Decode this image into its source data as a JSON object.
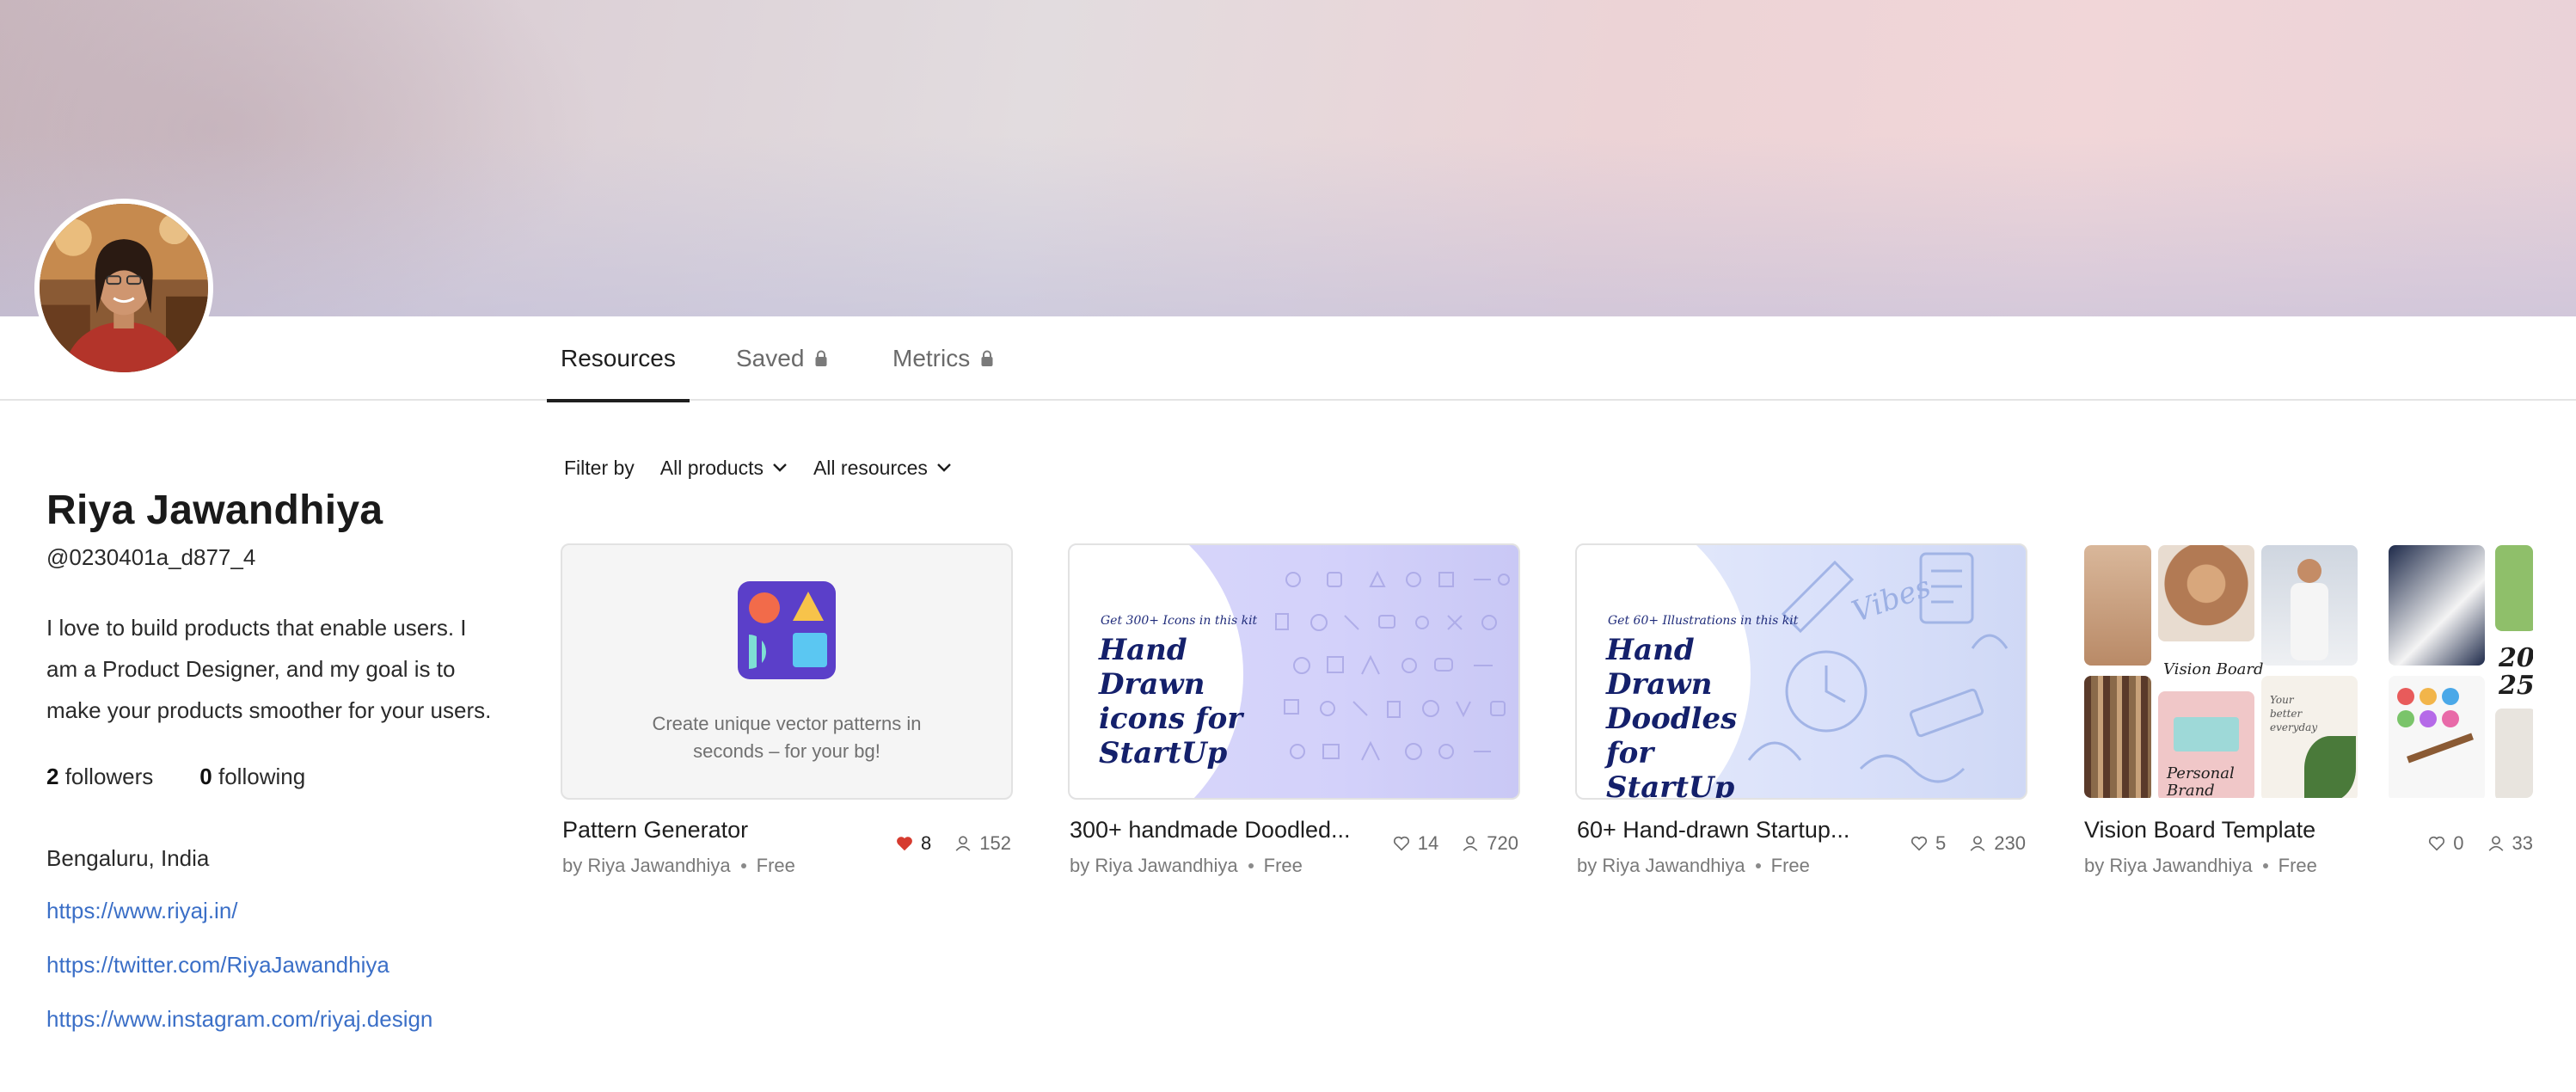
{
  "profile": {
    "name": "Riya Jawandhiya",
    "handle": "@0230401a_d877_4",
    "bio": "I love to build products that enable users. I am a Product Designer, and my goal is to make your products smoother for your users.",
    "followers_count": "2",
    "followers_label": "followers",
    "following_count": "0",
    "following_label": "following",
    "location": "Bengaluru, India",
    "links": [
      "https://www.riyaj.in/",
      "https://twitter.com/RiyaJawandhiya",
      "https://www.instagram.com/riyaj.design"
    ]
  },
  "tabs": [
    {
      "label": "Resources",
      "active": true,
      "locked": false
    },
    {
      "label": "Saved",
      "active": false,
      "locked": true
    },
    {
      "label": "Metrics",
      "active": false,
      "locked": true
    }
  ],
  "filter": {
    "label": "Filter by",
    "products": "All products",
    "resources": "All resources"
  },
  "cards": [
    {
      "title": "Pattern Generator",
      "author": "by Riya Jawandhiya",
      "price": "Free",
      "likes": "8",
      "users": "152",
      "liked": true,
      "caption": "Create unique vector patterns in seconds – for your bg!"
    },
    {
      "title": "300+ handmade Doodled...",
      "author": "by Riya Jawandhiya",
      "price": "Free",
      "likes": "14",
      "users": "720",
      "liked": false,
      "kit_small": "Get 300+ Icons in this kit",
      "kit_big": "Hand Drawn icons for StartUp"
    },
    {
      "title": "60+ Hand-drawn Startup...",
      "author": "by Riya Jawandhiya",
      "price": "Free",
      "likes": "5",
      "users": "230",
      "liked": false,
      "kit_small": "Get 60+ Illustrations in this kit",
      "kit_big": "Hand Drawn Doodles for StartUp",
      "word": "Vibes"
    },
    {
      "title": "Vision Board Template",
      "author": "by Riya Jawandhiya",
      "price": "Free",
      "likes": "0",
      "users": "33",
      "liked": false,
      "vb_label": "Vision Board",
      "vb_year": "20 25",
      "vb_brand": "Personal Brand",
      "vb_note": "Your better everyday"
    }
  ],
  "colors": {
    "link": "#3b6fc7",
    "heart_active": "#d63b2f",
    "text": "#1e1e1e",
    "muted": "#7a7a7a"
  }
}
